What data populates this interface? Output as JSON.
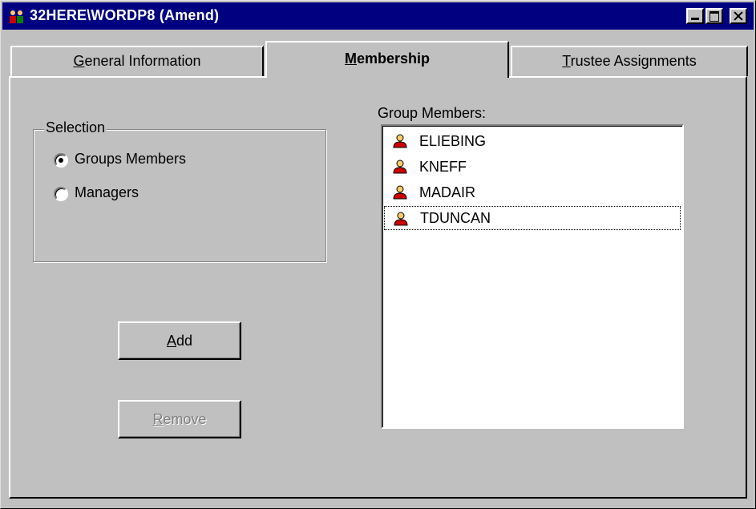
{
  "window": {
    "title": "32HERE\\WORDP8 (Amend)",
    "title_bar_color": "#000080"
  },
  "tabs": [
    {
      "label": "General Information",
      "mnemonic": "G",
      "rest": "eneral Information"
    },
    {
      "label": "Membership",
      "mnemonic": "M",
      "rest": "embership",
      "active": true
    },
    {
      "label": "Trustee Assignments",
      "mnemonic": "T",
      "rest": "rustee Assignments"
    }
  ],
  "selection": {
    "legend": "Selection",
    "options": [
      {
        "label": "Groups Members",
        "checked": true
      },
      {
        "label": "Managers",
        "checked": false
      }
    ]
  },
  "buttons": {
    "add": {
      "mnemonic": "A",
      "rest": "dd",
      "enabled": true
    },
    "remove": {
      "mnemonic": "R",
      "rest": "emove",
      "enabled": false
    }
  },
  "group_members": {
    "label": "Group Members:",
    "items": [
      "ELIEBING",
      "KNEFF",
      "MADAIR",
      "TDUNCAN"
    ],
    "focused_item": "TDUNCAN",
    "icon": "user-icon"
  }
}
